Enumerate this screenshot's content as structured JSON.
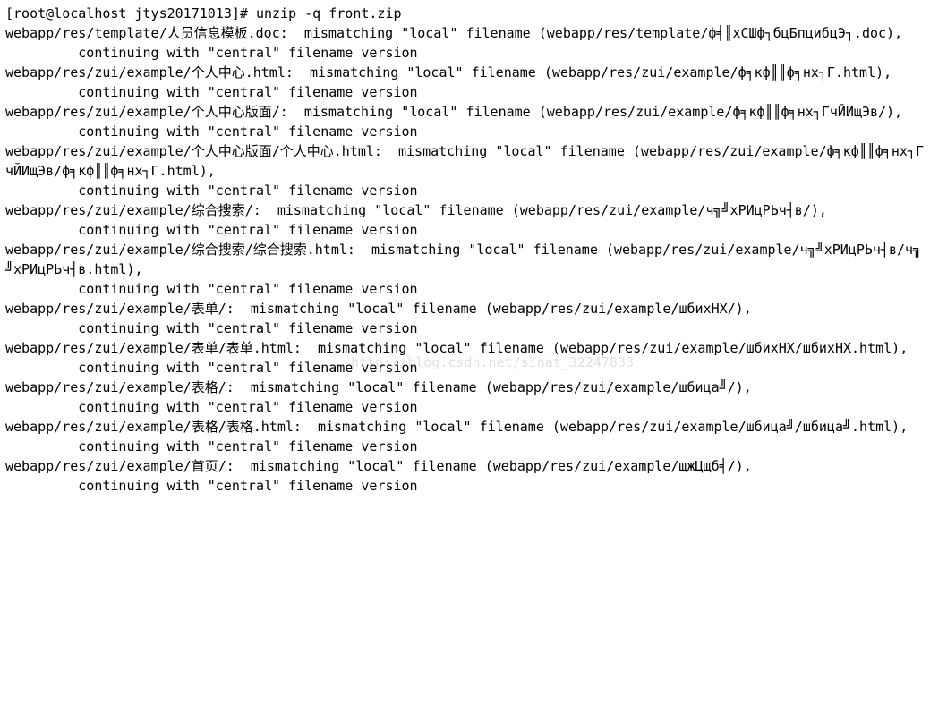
{
  "terminal": {
    "lines": [
      "[root@localhost jtys20171013]# unzip -q front.zip",
      "webapp/res/template/人员信息模板.doc:  mismatching \"local\" filename (webapp/res/template/ф╡║хСШф┐бцБпцибцЭ┐.doc),",
      "         continuing with \"central\" filename version",
      "webapp/res/zui/example/个人中心.html:  mismatching \"local\" filename (webapp/res/zui/example/ф╕кф║║ф╕нх┐Г.html),",
      "         continuing with \"central\" filename version",
      "webapp/res/zui/example/个人中心版面/:  mismatching \"local\" filename (webapp/res/zui/example/ф╕кф║║ф╕нх┐ГчЙИщЭв/),",
      "         continuing with \"central\" filename version",
      "webapp/res/zui/example/个人中心版面/个人中心.html:  mismatching \"local\" filename (webapp/res/zui/example/ф╕кф║║ф╕нх┐ГчЙИщЭв/ф╕кф║║ф╕нх┐Г.html),",
      "         continuing with \"central\" filename version",
      "webapp/res/zui/example/综合搜索/:  mismatching \"local\" filename (webapp/res/zui/example/ч╗╝хРИцРЬч┤в/),",
      "         continuing with \"central\" filename version",
      "webapp/res/zui/example/综合搜索/综合搜索.html:  mismatching \"local\" filename (webapp/res/zui/example/ч╗╝хРИцРЬч┤в/ч╗╝хРИцРЬч┤в.html),",
      "         continuing with \"central\" filename version",
      "webapp/res/zui/example/表单/:  mismatching \"local\" filename (webapp/res/zui/example/шбихНХ/),",
      "         continuing with \"central\" filename version",
      "webapp/res/zui/example/表单/表单.html:  mismatching \"local\" filename (webapp/res/zui/example/шбихНХ/шбихНХ.html),",
      "         continuing with \"central\" filename version",
      "webapp/res/zui/example/表格/:  mismatching \"local\" filename (webapp/res/zui/example/шбица╝/),",
      "         continuing with \"central\" filename version",
      "webapp/res/zui/example/表格/表格.html:  mismatching \"local\" filename (webapp/res/zui/example/шбица╝/шбица╝.html),",
      "         continuing with \"central\" filename version",
      "webapp/res/zui/example/首页/:  mismatching \"local\" filename (webapp/res/zui/example/щжЦщб╡/),",
      "         continuing with \"central\" filename version"
    ]
  },
  "watermark": "http://blog.csdn.net/sinat_32247833"
}
